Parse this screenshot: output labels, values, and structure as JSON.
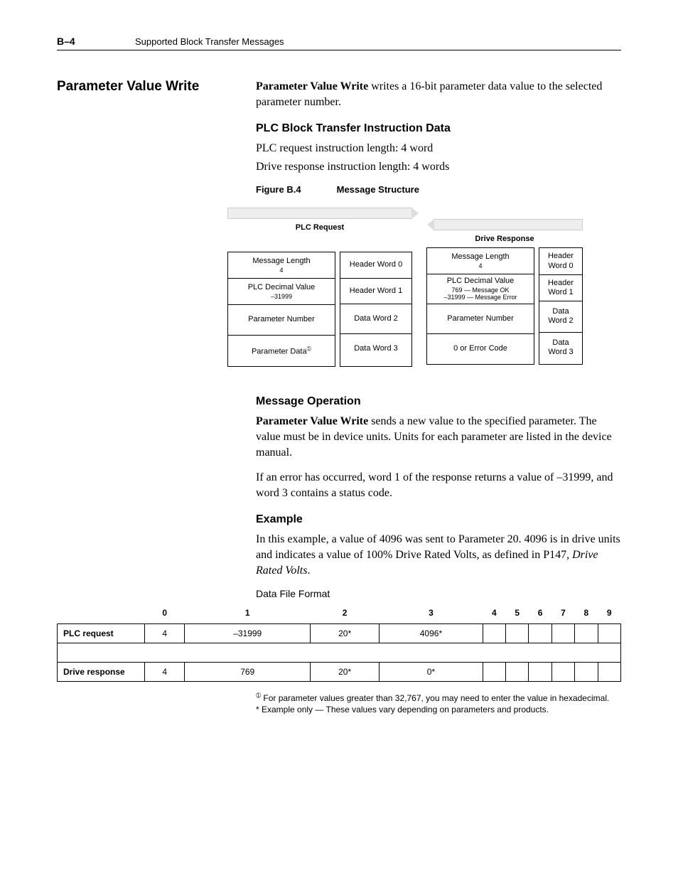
{
  "header": {
    "page": "B–4",
    "title": "Supported Block Transfer Messages"
  },
  "section_title": "Parameter Value Write",
  "intro": {
    "bold": "Parameter Value Write",
    "rest": " writes a 16-bit parameter data value to the selected parameter number."
  },
  "plc_block": {
    "heading": "PLC Block Transfer Instruction Data",
    "line1": "PLC request instruction length: 4 word",
    "line2": "Drive response instruction length: 4 words"
  },
  "figure": {
    "label": "Figure B.4",
    "title": "Message Structure"
  },
  "diagram": {
    "plc_request_title": "PLC Request",
    "drive_response_title": "Drive Response",
    "plc_left": [
      {
        "main": "Message Length",
        "sub": "4"
      },
      {
        "main": "PLC Decimal Value",
        "sub": "–31999"
      },
      {
        "main": "Parameter Number",
        "sub": ""
      },
      {
        "main": "Parameter Data",
        "sup": "➀",
        "sub": ""
      }
    ],
    "plc_right": [
      "Header Word 0",
      "Header Word 1",
      "Data Word 2",
      "Data Word 3"
    ],
    "drv_left": [
      {
        "main": "Message Length",
        "sub": "4"
      },
      {
        "main": "PLC Decimal Value",
        "sub": "769 — Message OK",
        "sub2": "–31999 — Message Error"
      },
      {
        "main": "Parameter Number",
        "sub": ""
      },
      {
        "main": "0 or Error Code",
        "sub": ""
      }
    ],
    "drv_right": [
      "Header Word 0",
      "Header Word 1",
      "Data Word 2",
      "Data Word 3"
    ]
  },
  "msg_op": {
    "heading": "Message Operation",
    "p1_bold": "Parameter Value Write",
    "p1_rest": " sends a new value to the specified parameter. The value must be in device units. Units for each parameter are listed in the device manual.",
    "p2": "If an error has occurred, word 1 of the response returns a value of –31999, and word 3 contains a status code."
  },
  "example": {
    "heading": "Example",
    "p1a": "In this example, a value of 4096 was sent to Parameter 20. 4096 is in drive units and indicates a value of 100% Drive Rated Volts, as defined in P147, ",
    "p1_italic": "Drive Rated Volts",
    "p1b": ".",
    "data_file_label": "Data File Format"
  },
  "table": {
    "cols": [
      "0",
      "1",
      "2",
      "3",
      "4",
      "5",
      "6",
      "7",
      "8",
      "9"
    ],
    "rows": [
      {
        "label": "PLC request",
        "cells": [
          "4",
          "–31999",
          "20*",
          "4096*",
          "",
          "",
          "",
          "",
          "",
          ""
        ]
      },
      {
        "label": "Drive response",
        "cells": [
          "4",
          "769",
          "20*",
          "0*",
          "",
          "",
          "",
          "",
          "",
          ""
        ]
      }
    ]
  },
  "footnotes": {
    "f1_sup": "➀",
    "f1": " For parameter values greater than 32,767, you may need to enter the value in hexadecimal.",
    "f2": "* Example only — These values vary depending on parameters and products."
  }
}
